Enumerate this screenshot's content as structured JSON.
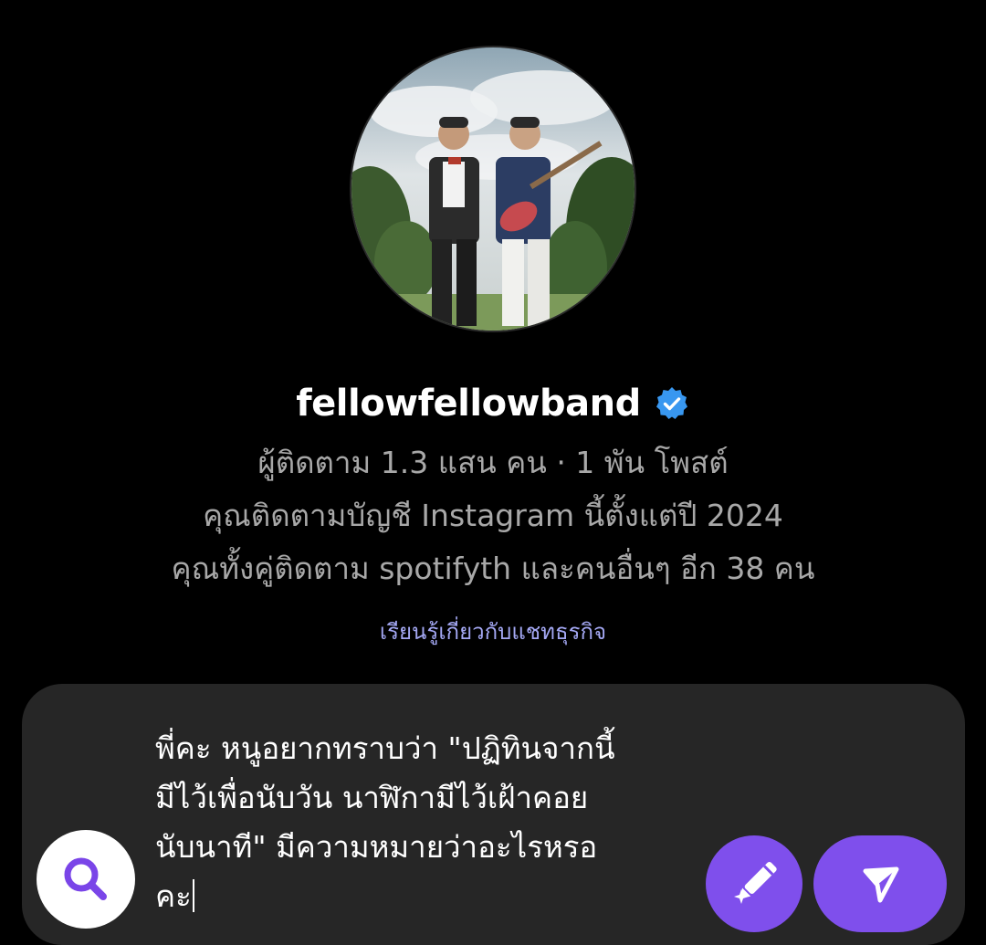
{
  "profile": {
    "username": "fellowfellowband",
    "verified_icon": "verified-badge-icon",
    "verified_color": "#3897f0",
    "followers_line": "ผู้ติดตาม 1.3 แสน คน · 1 พัน โพสต์",
    "since_line": "คุณติดตามบัญชี Instagram นี้ตั้งแต่ปี 2024",
    "mutual_line": "คุณทั้งคู่ติดตาม spotifyth และคนอื่นๆ อีก 38 คน",
    "learn_link": "เรียนรู้เกี่ยวกับแชทธุรกิจ"
  },
  "composer": {
    "message": "พี่คะ หนูอยากทราบว่า \"ปฏิทินจากนี้\nมีไว้เพื่อนับวัน นาฬิกามีไว้เฝ้าคอย\nนับนาที\" มีความหมายว่าอะไรหรอ\nคะ",
    "search_icon": "search-icon",
    "ai_icon": "pencil-sparkle-icon",
    "send_icon": "send-icon",
    "accent_color": "#7f4fec"
  },
  "theme": {
    "background": "#000000",
    "composer_background": "#262626",
    "secondary_text": "#a8a8a8",
    "link_color": "#a4a8f4"
  }
}
